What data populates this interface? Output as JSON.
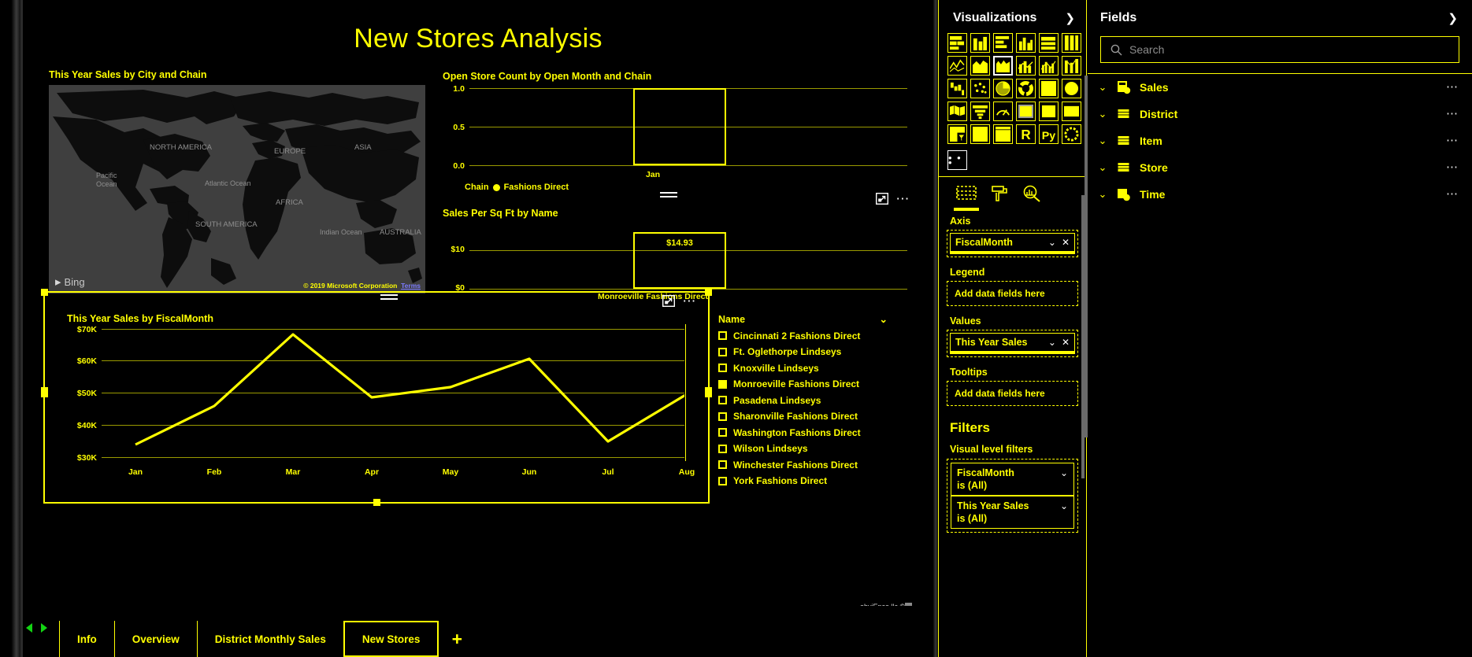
{
  "report": {
    "title": "New Stores Analysis",
    "watermark": "obviEnce llc ©"
  },
  "map_visual": {
    "title": "This Year Sales by City and Chain",
    "provider": "Bing",
    "credit": "© 2019 Microsoft Corporation",
    "credit_link": "Terms",
    "labels": [
      "NORTH AMERICA",
      "EUROPE",
      "ASIA",
      "AFRICA",
      "SOUTH AMERICA",
      "AUSTRALIA",
      "Pacific Ocean",
      "Atlantic Ocean",
      "Indian Ocean"
    ]
  },
  "store_count_visual": {
    "title": "Open Store Count by Open Month and Chain",
    "legend_label": "Chain",
    "legend_value": "Fashions Direct"
  },
  "sqft_visual": {
    "title": "Sales Per Sq Ft by Name",
    "bar_label": "$14.93"
  },
  "line_visual": {
    "title": "This Year Sales by FiscalMonth",
    "legend_title": "Name",
    "legend_items": [
      {
        "label": "Cincinnati 2 Fashions Direct",
        "selected": false
      },
      {
        "label": "Ft. Oglethorpe Lindseys",
        "selected": false
      },
      {
        "label": "Knoxville Lindseys",
        "selected": false
      },
      {
        "label": "Monroeville Fashions Direct",
        "selected": true
      },
      {
        "label": "Pasadena Lindseys",
        "selected": false
      },
      {
        "label": "Sharonville Fashions Direct",
        "selected": false
      },
      {
        "label": "Washington Fashions Direct",
        "selected": false
      },
      {
        "label": "Wilson Lindseys",
        "selected": false
      },
      {
        "label": "Winchester Fashions Direct",
        "selected": false
      },
      {
        "label": "York Fashions Direct",
        "selected": false
      }
    ]
  },
  "chart_data": [
    {
      "type": "bar",
      "title": "Open Store Count by Open Month and Chain",
      "categories": [
        "Jan"
      ],
      "values": [
        1.0
      ],
      "xlabel": "",
      "ylabel": "",
      "ylim": [
        0.0,
        1.0
      ],
      "yticks": [
        "0.0",
        "0.5",
        "1.0"
      ],
      "legend": {
        "label": "Chain",
        "entries": [
          "Fashions Direct"
        ]
      },
      "grid": true,
      "legend_position": "bottom-left"
    },
    {
      "type": "bar",
      "title": "Sales Per Sq Ft by Name",
      "categories": [
        "Monroeville Fashions Direct"
      ],
      "values": [
        14.93
      ],
      "data_labels": [
        "$14.93"
      ],
      "xlabel": "",
      "ylabel": "",
      "ylim": [
        0,
        20
      ],
      "yticks": [
        "$0",
        "$10"
      ],
      "grid": true
    },
    {
      "type": "line",
      "title": "This Year Sales by FiscalMonth",
      "categories": [
        "Jan",
        "Feb",
        "Mar",
        "Apr",
        "May",
        "Jun",
        "Jul",
        "Aug"
      ],
      "series": [
        {
          "name": "This Year Sales",
          "values": [
            34000,
            48000,
            69000,
            49000,
            52000,
            60200,
            37500,
            49500
          ]
        }
      ],
      "xlabel": "FiscalMonth",
      "ylabel": "This Year Sales",
      "ylim": [
        30000,
        70000
      ],
      "yticks": [
        "$30K",
        "$40K",
        "$50K",
        "$60K",
        "$70K"
      ],
      "grid": true,
      "legend_position": "right"
    }
  ],
  "visualizations_pane": {
    "title": "Visualizations",
    "more_label": "• • •",
    "icons": [
      "stacked-bar-chart-icon",
      "stacked-column-chart-icon",
      "clustered-bar-chart-icon",
      "clustered-column-chart-icon",
      "hundred-percent-stacked-bar-chart-icon",
      "hundred-percent-stacked-column-chart-icon",
      "line-chart-icon",
      "area-chart-icon",
      "stacked-area-chart-icon",
      "line-and-stacked-column-chart-icon",
      "line-and-clustered-column-chart-icon",
      "ribbon-chart-icon",
      "waterfall-chart-icon",
      "scatter-chart-icon",
      "pie-chart-icon",
      "donut-chart-icon",
      "treemap-icon",
      "filled-map-icon",
      "map-icon",
      "funnel-icon",
      "gauge-icon",
      "multi-row-card-icon",
      "card-icon",
      "kpi-icon",
      "slicer-icon",
      "table-icon",
      "matrix-icon",
      "r-script-visual-icon",
      "python-visual-icon",
      "key-influencers-icon"
    ],
    "property_tabs": [
      "fields-tab",
      "format-tab",
      "analytics-tab"
    ],
    "selected_property_tab": "fields-tab",
    "wells": [
      {
        "label": "Axis",
        "value": "FiscalMonth",
        "empty": false
      },
      {
        "label": "Legend",
        "value": "Add data fields here",
        "empty": true
      },
      {
        "label": "Values",
        "value": "This Year Sales",
        "empty": false
      },
      {
        "label": "Tooltips",
        "value": "Add data fields here",
        "empty": true
      }
    ],
    "filters": {
      "title": "Filters",
      "subtitle": "Visual level filters",
      "items": [
        {
          "name": "FiscalMonth",
          "condition": "is (All)"
        },
        {
          "name": "This Year Sales",
          "condition": "is (All)"
        }
      ]
    }
  },
  "fields_pane": {
    "title": "Fields",
    "search_placeholder": "Search",
    "tables": [
      {
        "name": "Sales",
        "icon": "measure-table-icon"
      },
      {
        "name": "District",
        "icon": "table-icon"
      },
      {
        "name": "Item",
        "icon": "table-icon"
      },
      {
        "name": "Store",
        "icon": "table-icon"
      },
      {
        "name": "Time",
        "icon": "measure-table-icon"
      }
    ]
  },
  "tabbar": {
    "tabs": [
      {
        "label": "Info",
        "active": false
      },
      {
        "label": "Overview",
        "active": false
      },
      {
        "label": "District Monthly Sales",
        "active": false
      },
      {
        "label": "New Stores",
        "active": true
      }
    ],
    "add_label": "+"
  }
}
